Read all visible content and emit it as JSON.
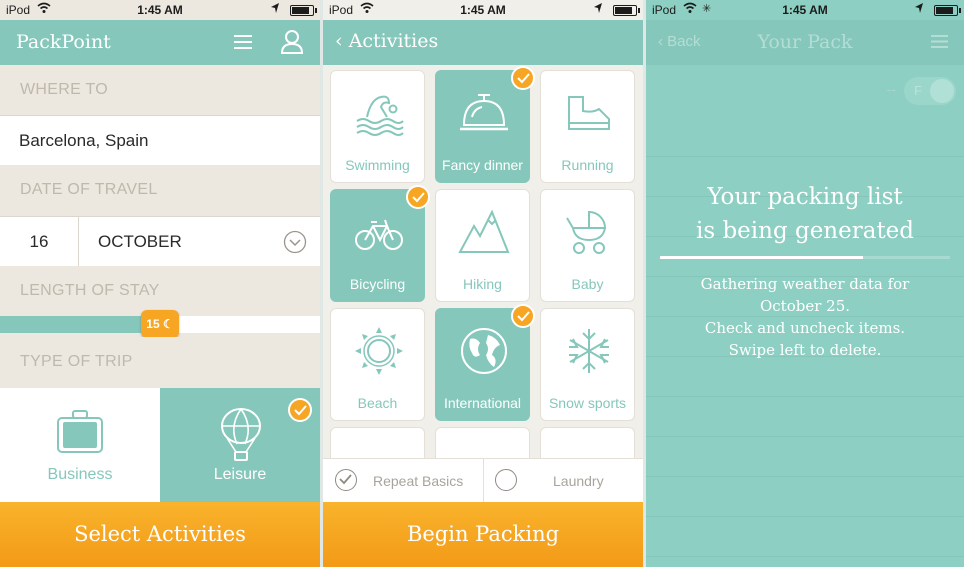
{
  "status": {
    "carrier": "iPod",
    "time": "1:45 AM"
  },
  "screen1": {
    "brand": "PackPoint",
    "where_label": "WHERE TO",
    "where_value": "Barcelona, Spain",
    "date_label": "DATE OF TRAVEL",
    "day": "16",
    "month": "OCTOBER",
    "length_label": "LENGTH OF STAY",
    "length_value": "15",
    "length_fraction": 0.5,
    "trip_label": "TYPE OF TRIP",
    "trips": [
      {
        "label": "Business",
        "selected": false
      },
      {
        "label": "Leisure",
        "selected": true
      }
    ],
    "cta": "Select Activities"
  },
  "screen2": {
    "title": "Activities",
    "activities": [
      {
        "label": "Swimming",
        "selected": false,
        "icon": "swimming-icon"
      },
      {
        "label": "Fancy dinner",
        "selected": true,
        "icon": "cloche-icon"
      },
      {
        "label": "Running",
        "selected": false,
        "icon": "shoe-icon"
      },
      {
        "label": "Bicycling",
        "selected": true,
        "icon": "bicycle-icon"
      },
      {
        "label": "Hiking",
        "selected": false,
        "icon": "mountain-icon"
      },
      {
        "label": "Baby",
        "selected": false,
        "icon": "stroller-icon"
      },
      {
        "label": "Beach",
        "selected": false,
        "icon": "sun-icon"
      },
      {
        "label": "International",
        "selected": true,
        "icon": "globe-icon"
      },
      {
        "label": "Snow sports",
        "selected": false,
        "icon": "snowflake-icon"
      }
    ],
    "options": [
      "Repeat Basics",
      "Laundry"
    ],
    "cta": "Begin Packing"
  },
  "screen3": {
    "back": "Back",
    "title": "Your Pack",
    "title_line1": "Your packing list",
    "title_line2": "is being generated",
    "progress": 0.7,
    "msg_line1": "Gathering weather data for",
    "msg_line2": "October 25.",
    "msg_line3": "Check and uncheck items.",
    "msg_line4": "Swipe left to delete."
  },
  "colors": {
    "teal": "#86c7bb",
    "orange": "#f6a623",
    "beige": "#ece8e0"
  }
}
